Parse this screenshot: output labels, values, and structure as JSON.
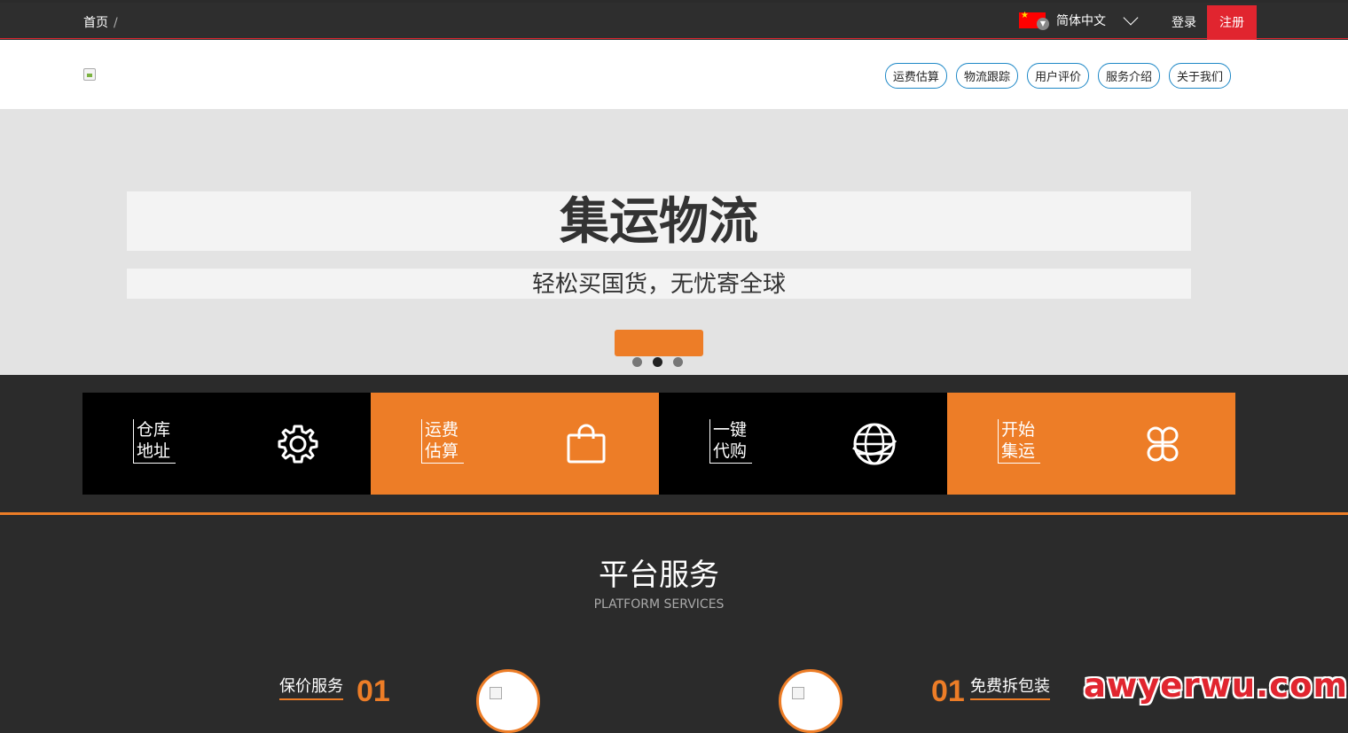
{
  "topbar": {
    "breadcrumb_home": "首页",
    "breadcrumb_sep": "/",
    "language": "简体中文",
    "login": "登录",
    "register": "注册"
  },
  "nav": {
    "items": [
      "运费估算",
      "物流跟踪",
      "用户评价",
      "服务介绍",
      "关于我们"
    ]
  },
  "hero": {
    "title": "集运物流",
    "subtitle": "轻松买国货，无忧寄全球",
    "slides_count": 3,
    "active_slide": 2
  },
  "tiles": [
    {
      "line1": "仓库",
      "line2": "地址",
      "icon": "gear-icon",
      "style": "black"
    },
    {
      "line1": "运费",
      "line2": "估算",
      "icon": "shopping-bag-icon",
      "style": "orange"
    },
    {
      "line1": "一键",
      "line2": "代购",
      "icon": "globe-icon",
      "style": "black"
    },
    {
      "line1": "开始",
      "line2": "集运",
      "icon": "clover-icon",
      "style": "orange"
    }
  ],
  "platform": {
    "title": "平台服务",
    "subtitle": "PLATFORM SERVICES",
    "services": [
      {
        "name": "保价服务",
        "number": "01"
      },
      {
        "name": "免费拆包装",
        "number": "01"
      }
    ]
  },
  "watermark": "awyerwu.com",
  "colors": {
    "accent": "#ed7d27",
    "brand_red": "#e1252f",
    "dark": "#2e2e2e"
  }
}
